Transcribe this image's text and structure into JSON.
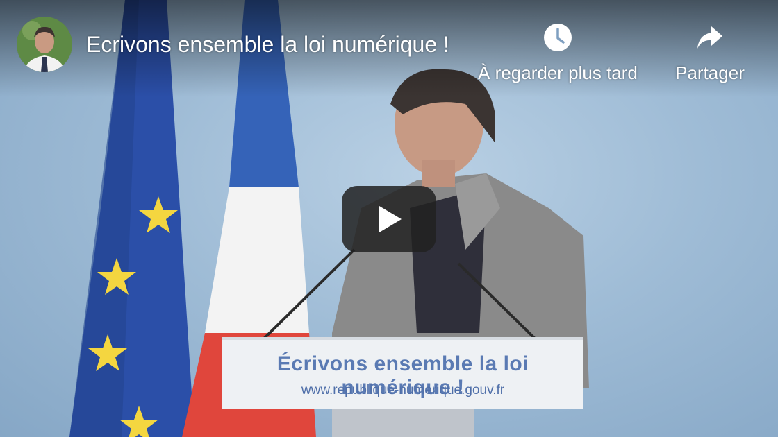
{
  "video": {
    "title": "Ecrivons ensemble la loi numérique !",
    "channel_avatar_icon": "person-avatar"
  },
  "actions": {
    "watch_later": {
      "label": "À regarder plus tard",
      "icon": "clock-icon"
    },
    "share": {
      "label": "Partager",
      "icon": "share-arrow-icon"
    }
  },
  "player": {
    "play_icon": "play-icon",
    "accent": "#212121"
  },
  "scene": {
    "lectern_title": "Écrivons ensemble la loi numérique !",
    "lectern_url": "www.republique-numerique.gouv.fr"
  },
  "colors": {
    "flag_blue": "#2b4fa8",
    "flag_red": "#e0463c",
    "star_yellow": "#f4d640"
  }
}
